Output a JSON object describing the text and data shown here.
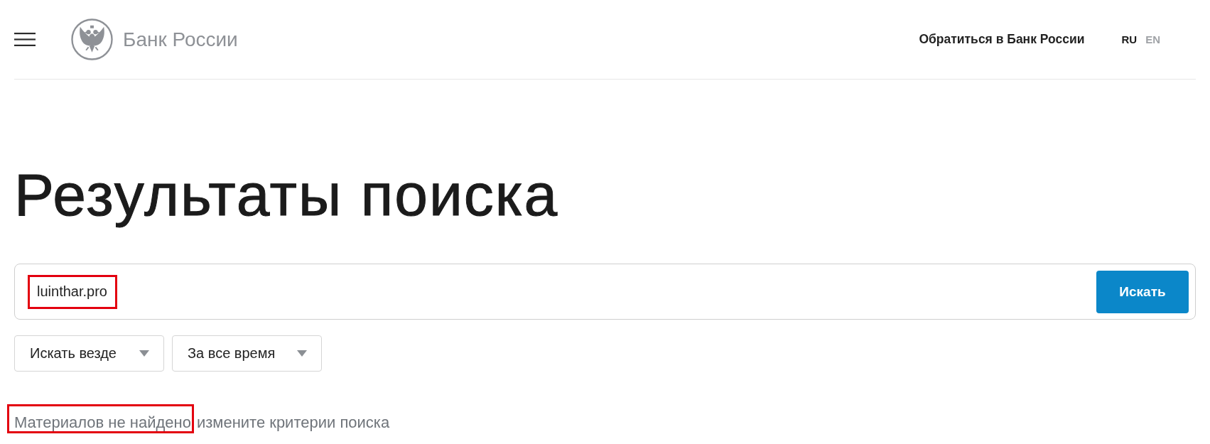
{
  "header": {
    "logo_text": "Банк России",
    "contact_link": "Обратиться в Банк России",
    "languages": [
      {
        "label": "RU",
        "selected": true
      },
      {
        "label": "EN",
        "selected": false
      }
    ]
  },
  "title": "Результаты поиска",
  "search": {
    "query": "luinthar.pro",
    "query_highlighted": true,
    "button": "Искать"
  },
  "filters": [
    {
      "label": "Искать везде"
    },
    {
      "label": "За все время"
    }
  ],
  "message": [
    {
      "text": "Материалов не найдено",
      "highlighted": true
    },
    {
      "text": "измените критерии поиска",
      "highlighted": false
    }
  ]
}
